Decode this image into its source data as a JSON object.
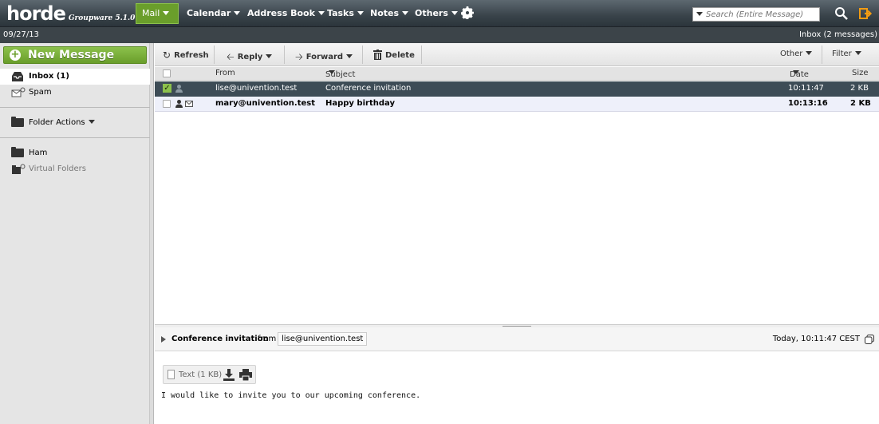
{
  "app": {
    "logo": "horde",
    "product": "Groupware 5.1.0"
  },
  "menu": {
    "mail": "Mail",
    "calendar": "Calendar",
    "address_book": "Address Book",
    "tasks": "Tasks",
    "notes": "Notes",
    "others": "Others"
  },
  "search": {
    "placeholder": "Search (Entire Message)"
  },
  "status": {
    "date": "09/27/13",
    "folder_info": "Inbox (2 messages)"
  },
  "sidebar": {
    "new_message": "New Message",
    "inbox": "Inbox (1)",
    "spam": "Spam",
    "folder_actions": "Folder Actions",
    "ham": "Ham",
    "virtual_folders": "Virtual Folders"
  },
  "toolbar": {
    "refresh": "Refresh",
    "reply": "Reply",
    "forward": "Forward",
    "delete": "Delete",
    "other": "Other",
    "filter": "Filter"
  },
  "columns": {
    "from": "From",
    "subject": "Subject",
    "date": "Date",
    "size": "Size"
  },
  "messages": [
    {
      "from": "lise@univention.test",
      "subject": "Conference invitation",
      "date": "10:11:47",
      "size": "2 KB",
      "selected": true,
      "unread": false
    },
    {
      "from": "mary@univention.test",
      "subject": "Happy birthday",
      "date": "10:13:16",
      "size": "2 KB",
      "selected": false,
      "unread": true
    }
  ],
  "preview": {
    "subject": "Conference invitation",
    "from_word": "from",
    "from": "lise@univention.test",
    "date": "Today, 10:11:47 CEST",
    "attachment": "Text (1 KB)",
    "body": "I would like to invite you to our upcoming conference."
  },
  "colors": {
    "accent_green": "#6a9e2b",
    "topbar_dark": "#39434a",
    "selected_row": "#3d4c56"
  }
}
